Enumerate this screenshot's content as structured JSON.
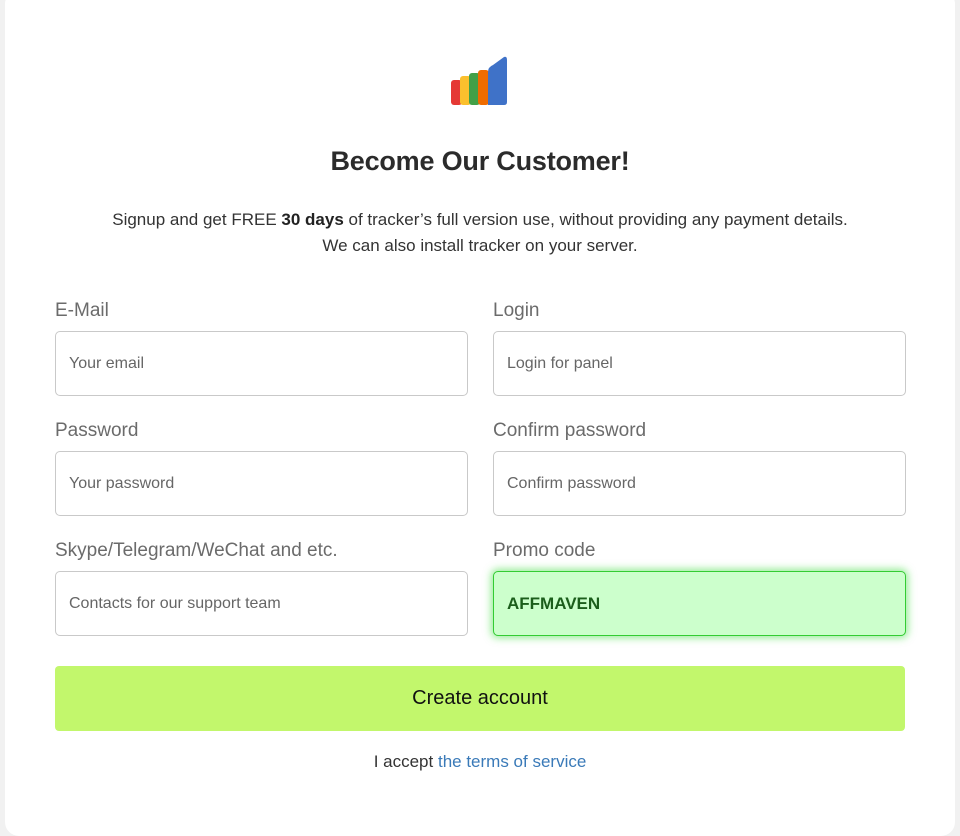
{
  "logo": {
    "icon": "bar-chart-logo-icon",
    "colors": [
      "#e53935",
      "#fbc02d",
      "#43a047",
      "#ef6c00",
      "#3f72c8"
    ]
  },
  "header": {
    "title": "Become Our Customer!",
    "subtitle_prefix": "Signup and get FREE ",
    "subtitle_bold": "30 days",
    "subtitle_suffix": " of tracker’s full version use, without providing any payment details.",
    "subtitle_line2": "We can also install tracker on your server."
  },
  "form": {
    "email": {
      "label": "E-Mail",
      "placeholder": "Your email",
      "value": ""
    },
    "login": {
      "label": "Login",
      "placeholder": "Login for panel",
      "value": ""
    },
    "password": {
      "label": "Password",
      "placeholder": "Your password",
      "value": ""
    },
    "confirm_password": {
      "label": "Confirm password",
      "placeholder": "Confirm password",
      "value": ""
    },
    "contacts": {
      "label": "Skype/Telegram/WeChat and etc.",
      "placeholder": "Contacts for our support team",
      "value": ""
    },
    "promo": {
      "label": "Promo code",
      "placeholder": "",
      "value": "AFFMAVEN"
    },
    "submit_label": "Create account"
  },
  "terms": {
    "prefix": "I accept ",
    "link_text": "the terms of service"
  },
  "colors": {
    "accent_button": "#c2f76c",
    "promo_bg": "#ccffcc",
    "link": "#3a7ab8"
  }
}
